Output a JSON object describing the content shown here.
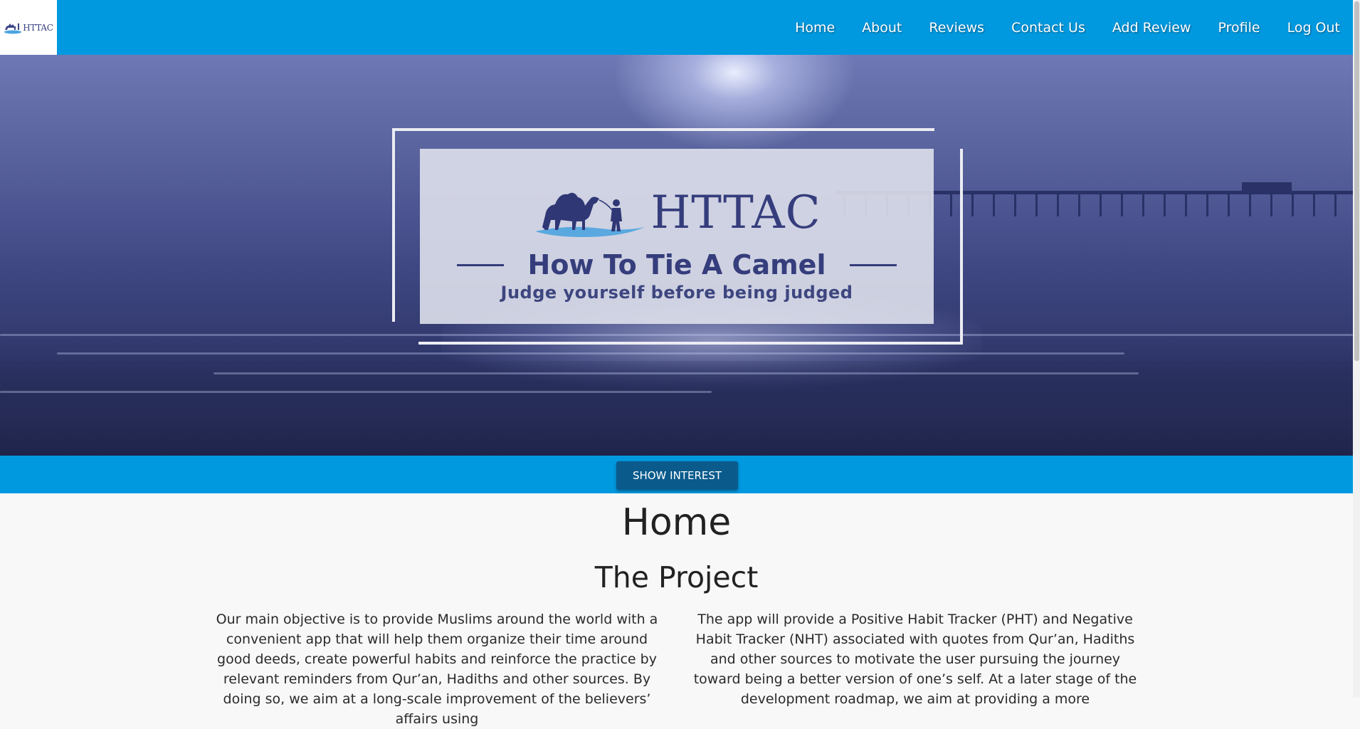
{
  "brand": {
    "logo_text": "HTTAC",
    "colors": {
      "primary": "#0099e0",
      "button": "#0a5b8c",
      "logo": "#353d7c"
    }
  },
  "nav": {
    "items": [
      {
        "label": "Home"
      },
      {
        "label": "About"
      },
      {
        "label": "Reviews"
      },
      {
        "label": "Contact Us"
      },
      {
        "label": "Add Review"
      },
      {
        "label": "Profile"
      },
      {
        "label": "Log Out"
      }
    ]
  },
  "hero": {
    "logo_text": "HTTAC",
    "title": "How To Tie A Camel",
    "tagline": "Judge yourself before being judged",
    "icon": "camel-icon"
  },
  "cta": {
    "label": "SHOW INTEREST"
  },
  "main": {
    "heading": "Home",
    "subheading": "The Project",
    "left_text": "Our main objective is to provide Muslims around the world with a convenient app that will help them organize their time around good deeds, create powerful habits and reinforce the practice by relevant reminders from Qur’an, Hadiths and other sources. By doing so, we aim at a long-scale improvement of the believers’ affairs using",
    "right_text": "The app will provide a Positive Habit Tracker (PHT) and Negative Habit Tracker (NHT) associated with quotes from Qur’an, Hadiths and other sources to motivate the user pursuing the journey toward being a better version of one’s self. At a later stage of the development roadmap, we aim at providing a more"
  }
}
